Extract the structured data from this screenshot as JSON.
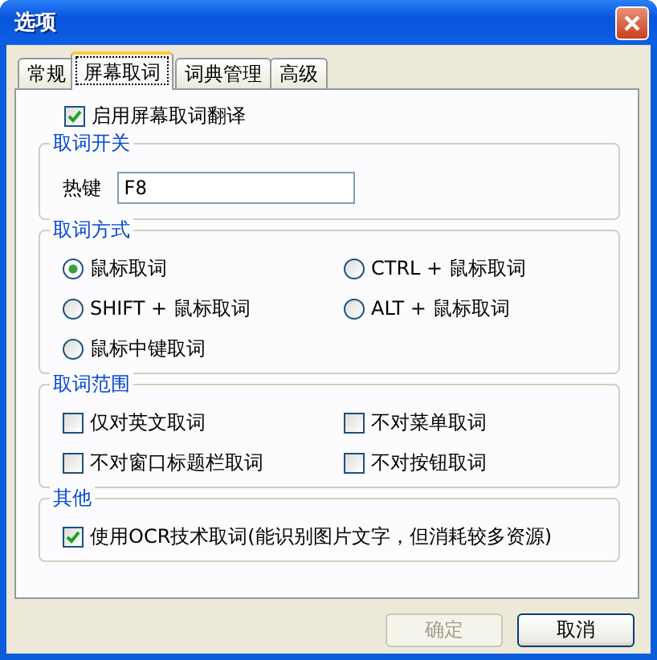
{
  "window": {
    "title": "选项"
  },
  "tabs": [
    {
      "label": "常规",
      "selected": false
    },
    {
      "label": "屏幕取词",
      "selected": true
    },
    {
      "label": "词典管理",
      "selected": false
    },
    {
      "label": "高级",
      "selected": false
    }
  ],
  "enable": {
    "label": "启用屏幕取词翻译",
    "checked": true
  },
  "groups": [
    {
      "kind": "hotkey",
      "title": "取词开关",
      "label": "热键",
      "value": "F8"
    },
    {
      "kind": "radios",
      "title": "取词方式",
      "items": [
        {
          "label": "鼠标取词",
          "selected": true
        },
        {
          "label": "CTRL + 鼠标取词",
          "selected": false
        },
        {
          "label": "SHIFT + 鼠标取词",
          "selected": false
        },
        {
          "label": "ALT + 鼠标取词",
          "selected": false
        },
        {
          "label": "鼠标中键取词",
          "selected": false
        }
      ]
    },
    {
      "kind": "checks",
      "title": "取词范围",
      "items": [
        {
          "label": "仅对英文取词",
          "checked": false
        },
        {
          "label": "不对菜单取词",
          "checked": false
        },
        {
          "label": "不对窗口标题栏取词",
          "checked": false
        },
        {
          "label": "不对按钮取词",
          "checked": false
        }
      ]
    },
    {
      "kind": "checks",
      "title": "其他",
      "items": [
        {
          "label": "使用OCR技术取词(能识别图片文字，但消耗较多资源)",
          "checked": true
        }
      ]
    }
  ],
  "buttons": [
    {
      "label": "确定",
      "disabled": true
    },
    {
      "label": "取消",
      "disabled": false
    }
  ]
}
